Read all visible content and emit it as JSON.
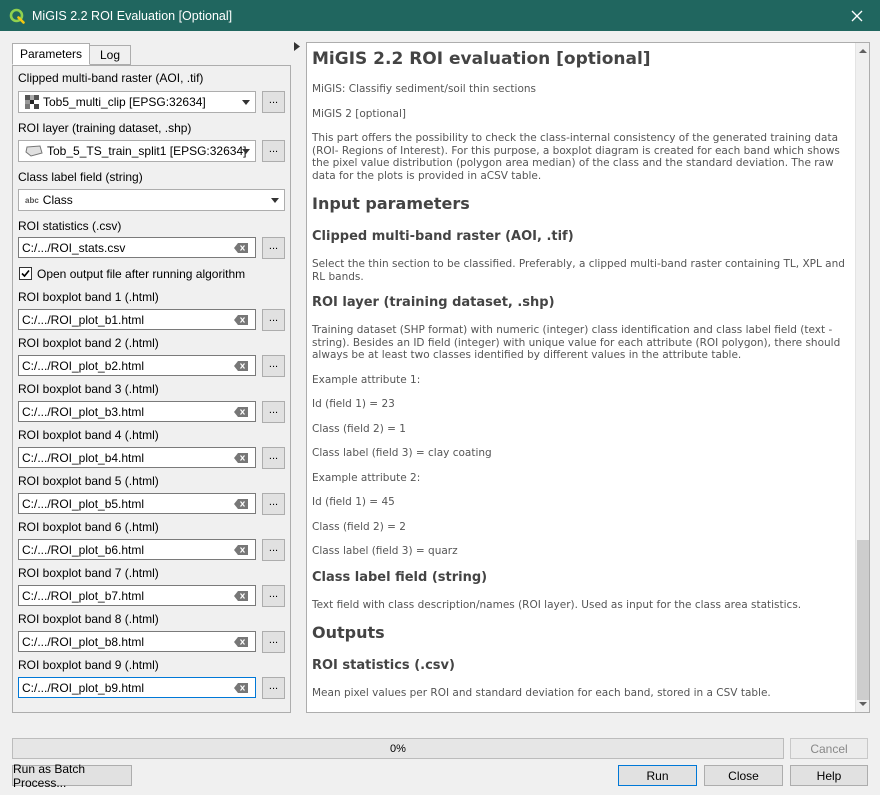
{
  "window": {
    "title": "MiGIS 2.2 ROI Evaluation [Optional]"
  },
  "tabs": [
    {
      "label": "Parameters"
    },
    {
      "label": "Log"
    }
  ],
  "params": {
    "raster_label": "Clipped multi-band raster (AOI, .tif)",
    "raster_value": "Tob5_multi_clip [EPSG:32634]",
    "roi_label": "ROI layer (training dataset, .shp)",
    "roi_value": "Tob_5_TS_train_split1 [EPSG:32634]",
    "class_field_label": "Class label field (string)",
    "class_field_prefix": "abc",
    "class_field_value": "Class",
    "stats_label": "ROI statistics (.csv)",
    "stats_value": "C:/.../ROI_stats.csv",
    "open_output_label": "Open output file after running algorithm",
    "ellipsis": "...",
    "bands": [
      {
        "label": "ROI boxplot band 1 (.html)",
        "value": "C:/.../ROI_plot_b1.html"
      },
      {
        "label": "ROI boxplot band 2 (.html)",
        "value": "C:/.../ROI_plot_b2.html"
      },
      {
        "label": "ROI boxplot band 3 (.html)",
        "value": "C:/.../ROI_plot_b3.html"
      },
      {
        "label": "ROI boxplot band 4 (.html)",
        "value": "C:/.../ROI_plot_b4.html"
      },
      {
        "label": "ROI boxplot band 5 (.html)",
        "value": "C:/.../ROI_plot_b5.html"
      },
      {
        "label": "ROI boxplot band 6 (.html)",
        "value": "C:/.../ROI_plot_b6.html"
      },
      {
        "label": "ROI boxplot band 7 (.html)",
        "value": "C:/.../ROI_plot_b7.html"
      },
      {
        "label": "ROI boxplot band 8 (.html)",
        "value": "C:/.../ROI_plot_b8.html"
      },
      {
        "label": "ROI boxplot band 9 (.html)",
        "value": "C:/.../ROI_plot_b9.html"
      }
    ]
  },
  "help": {
    "title": "MiGIS 2.2 ROI evaluation [optional]",
    "p1": "MiGIS: Classifiy sediment/soil thin sections",
    "p2": "MiGIS 2 [optional]",
    "p3": "This part offers the possibility to check the class-internal consistency of the generated training data (ROI- Regions of Interest). For this purpose, a boxplot diagram is created for each band which shows the pixel value distribution (polygon area median) of the class and the standard deviation. The raw data for the plots is provided in aCSV table.",
    "input_heading": "Input parameters",
    "raster_heading": "Clipped multi-band raster (AOI, .tif)",
    "raster_desc": "Select the thin section to be classified. Preferably, a clipped multi-band raster containing TL, XPL and RL bands.",
    "roi_heading": "ROI layer (training dataset, .shp)",
    "roi_desc": "Training dataset (SHP format) with numeric (integer) class identification and class label field (text - string). Besides an ID field (integer) with unique value for each attribute (ROI polygon), there should always be at least two classes identified by different values in the attribute table.",
    "ex1": "Example attribute 1:",
    "ex1_id": "Id (field 1) = 23",
    "ex1_class": "Class (field 2) = 1",
    "ex1_label": "Class label (field 3) = clay coating",
    "ex2": "Example attribute 2:",
    "ex2_id": "Id (field 1) = 45",
    "ex2_class": "Class (field 2) = 2",
    "ex2_label": "Class label (field 3) = quarz",
    "class_heading": "Class label field (string)",
    "class_desc": "Text field with class description/names (ROI layer). Used as input for the class area statistics.",
    "outputs_heading": "Outputs",
    "stats_heading": "ROI statistics (.csv)",
    "stats_desc": "Mean pixel values per ROI and standard deviation for each band, stored in a CSV table."
  },
  "footer": {
    "progress": 0,
    "progress_text": "0%",
    "cancel": "Cancel",
    "batch": "Run as Batch Process...",
    "run": "Run",
    "close": "Close",
    "help": "Help"
  }
}
